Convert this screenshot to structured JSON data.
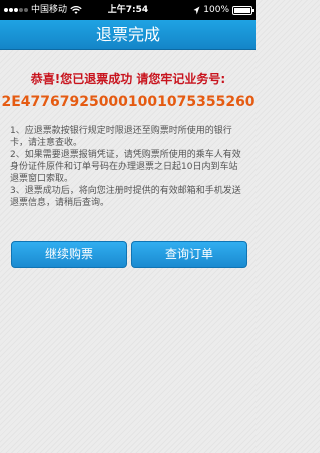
{
  "status_bar": {
    "carrier": "中国移动",
    "time": "上午7:54",
    "battery_level": "100%",
    "battery_fraction": 1.0
  },
  "header": {
    "title": "退票完成"
  },
  "result": {
    "success_message": "恭喜!您已退票成功 请您牢记业务号:",
    "business_number": "2E4776792500010010753552​60"
  },
  "notes": [
    "1、应退票款按银行规定时限退还至购票时所使用的银行卡，请注意查收。",
    "2、如果需要退票报销凭证，请凭购票所使用的乘车人有效身份证件原件和订单号码在办理退票之日起10日内到车站退票窗口索取。",
    "3、退票成功后，将向您注册时提供的有效邮箱和手机发送退票信息，请稍后查询。"
  ],
  "actions": {
    "continue_label": "继续购票",
    "query_label": "查询订单"
  },
  "colors": {
    "header_bg": "#1485c8",
    "success_text": "#c8131d",
    "order_number": "#e55b12",
    "button_bg": "#1a8ad0"
  }
}
